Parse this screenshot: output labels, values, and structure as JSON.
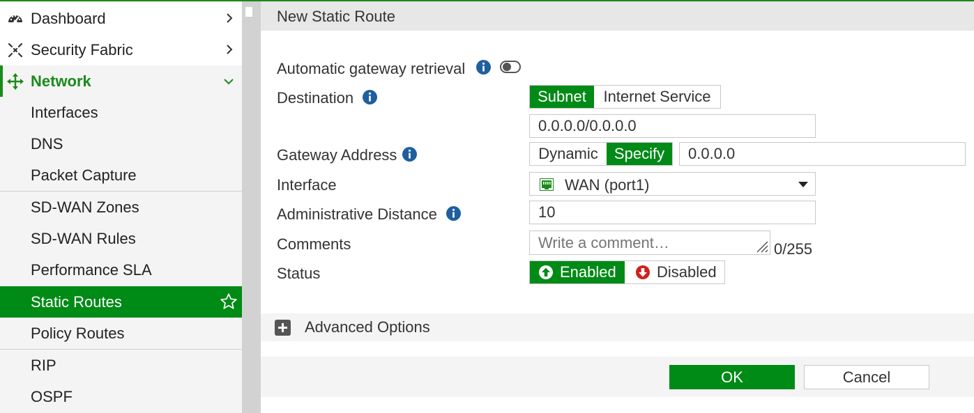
{
  "sidebar": {
    "items": [
      {
        "label": "Dashboard"
      },
      {
        "label": "Security Fabric"
      },
      {
        "label": "Network"
      },
      {
        "label": "Interfaces"
      },
      {
        "label": "DNS"
      },
      {
        "label": "Packet Capture"
      },
      {
        "label": "SD-WAN Zones"
      },
      {
        "label": "SD-WAN Rules"
      },
      {
        "label": "Performance SLA"
      },
      {
        "label": "Static Routes"
      },
      {
        "label": "Policy Routes"
      },
      {
        "label": "RIP"
      },
      {
        "label": "OSPF"
      }
    ]
  },
  "page": {
    "title": "New Static Route"
  },
  "form": {
    "auto_gateway": {
      "label": "Automatic gateway retrieval",
      "enabled": false
    },
    "destination": {
      "label": "Destination",
      "options": [
        "Subnet",
        "Internet Service"
      ],
      "selected": "Subnet",
      "value": "0.0.0.0/0.0.0.0"
    },
    "gateway": {
      "label": "Gateway Address",
      "options": [
        "Dynamic",
        "Specify"
      ],
      "selected": "Specify",
      "value": "0.0.0.0"
    },
    "interface": {
      "label": "Interface",
      "value": "WAN (port1)"
    },
    "admin_distance": {
      "label": "Administrative Distance",
      "value": "10"
    },
    "comments": {
      "label": "Comments",
      "placeholder": "Write a comment…",
      "counter": "0/255"
    },
    "status": {
      "label": "Status",
      "options": [
        "Enabled",
        "Disabled"
      ],
      "selected": "Enabled"
    }
  },
  "advanced": {
    "label": "Advanced Options"
  },
  "footer": {
    "ok_label": "OK",
    "cancel_label": "Cancel"
  },
  "colors": {
    "accent": "#008a16",
    "info": "#1f5f9e",
    "disabled": "#d0201e"
  }
}
